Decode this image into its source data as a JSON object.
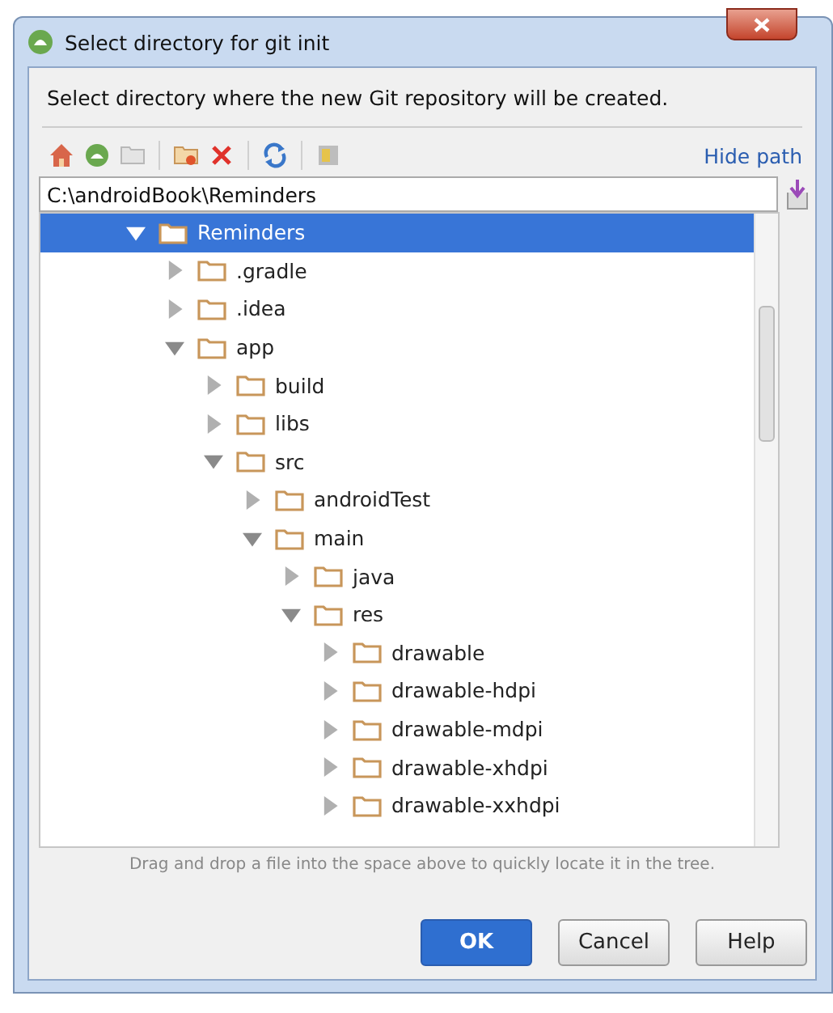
{
  "window": {
    "title": "Select directory for git init"
  },
  "description": "Select directory where the new Git repository will be created.",
  "toolbar": {
    "hide_path_link": "Hide path"
  },
  "path_field": {
    "value": "C:\\androidBook\\Reminders"
  },
  "tree": [
    {
      "name": "Reminders",
      "expanded": true,
      "selected": true,
      "children": [
        {
          "name": ".gradle",
          "expanded": false,
          "selected": false
        },
        {
          "name": ".idea",
          "expanded": false,
          "selected": false
        },
        {
          "name": "app",
          "expanded": true,
          "selected": false,
          "children": [
            {
              "name": "build",
              "expanded": false,
              "selected": false
            },
            {
              "name": "libs",
              "expanded": false,
              "selected": false
            },
            {
              "name": "src",
              "expanded": true,
              "selected": false,
              "children": [
                {
                  "name": "androidTest",
                  "expanded": false,
                  "selected": false
                },
                {
                  "name": "main",
                  "expanded": true,
                  "selected": false,
                  "children": [
                    {
                      "name": "java",
                      "expanded": false,
                      "selected": false
                    },
                    {
                      "name": "res",
                      "expanded": true,
                      "selected": false,
                      "children": [
                        {
                          "name": "drawable",
                          "expanded": false,
                          "selected": false
                        },
                        {
                          "name": "drawable-hdpi",
                          "expanded": false,
                          "selected": false
                        },
                        {
                          "name": "drawable-mdpi",
                          "expanded": false,
                          "selected": false
                        },
                        {
                          "name": "drawable-xhdpi",
                          "expanded": false,
                          "selected": false
                        },
                        {
                          "name": "drawable-xxhdpi",
                          "expanded": false,
                          "selected": false
                        }
                      ]
                    }
                  ]
                }
              ]
            }
          ]
        }
      ]
    }
  ],
  "hint": "Drag and drop a file into the space above to quickly locate it in the tree.",
  "buttons": [
    {
      "label": "OK",
      "kind": "primary"
    },
    {
      "label": "Cancel",
      "kind": "normal"
    },
    {
      "label": "Help",
      "kind": "normal"
    }
  ]
}
